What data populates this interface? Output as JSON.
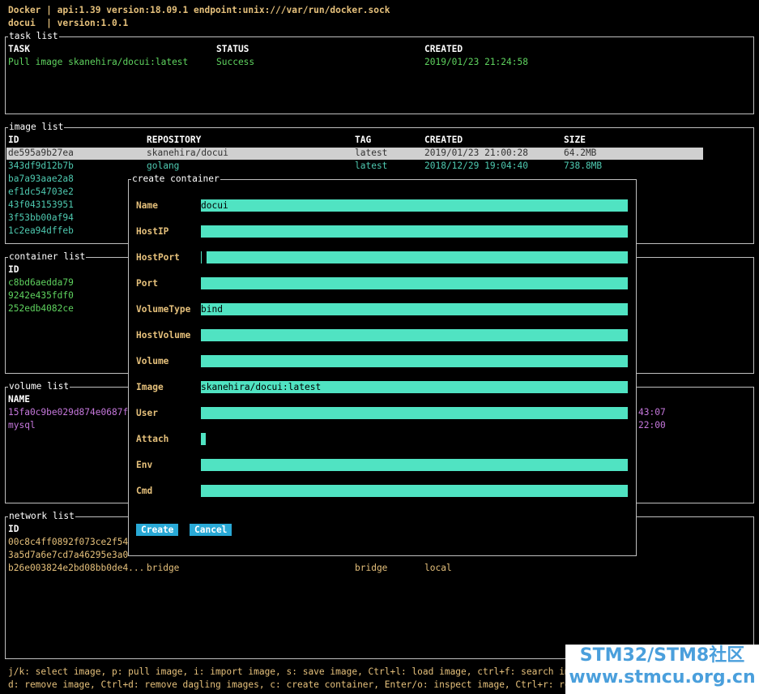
{
  "header": {
    "line1": "Docker | api:1.39 version:18.09.1 endpoint:unix:///var/run/docker.sock",
    "line2": "docui  | version:1.0.1"
  },
  "task_list": {
    "title": "task list",
    "columns": [
      "TASK",
      "STATUS",
      "CREATED"
    ],
    "rows": [
      {
        "task": "Pull image skanehira/docui:latest",
        "status": "Success",
        "created": "2019/01/23 21:24:58"
      }
    ]
  },
  "image_list": {
    "title": "image list",
    "columns": [
      "ID",
      "REPOSITORY",
      "TAG",
      "CREATED",
      "SIZE"
    ],
    "rows": [
      {
        "id": "de595a9b27ea",
        "repository": "skanehira/docui",
        "tag": "latest",
        "created": "2019/01/23 21:00:28",
        "size": "64.2MB"
      },
      {
        "id": "343df9d12b7b",
        "repository": "golang",
        "tag": "latest",
        "created": "2018/12/29 19:04:40",
        "size": "738.8MB"
      },
      {
        "id": "ba7a93aae2a8"
      },
      {
        "id": "ef1dc54703e2"
      },
      {
        "id": "43f043153951"
      },
      {
        "id": "3f53bb00af94"
      },
      {
        "id": "1c2ea94dffeb"
      }
    ]
  },
  "container_list": {
    "title": "container list",
    "columns": [
      "ID"
    ],
    "rows": [
      {
        "id": "c8bd6aedda79"
      },
      {
        "id": "9242e435fdf0"
      },
      {
        "id": "252edb4082ce"
      }
    ]
  },
  "volume_list": {
    "title": "volume list",
    "columns": [
      "NAME"
    ],
    "rows": [
      {
        "name": "15fa0c9be029d874e0687f",
        "tail": "43:07"
      },
      {
        "name": "mysql",
        "tail": "22:00"
      }
    ]
  },
  "network_list": {
    "title": "network list",
    "columns": [
      "ID"
    ],
    "rows": [
      {
        "id": "00c8c4ff0892f073ce2f54"
      },
      {
        "id": "3a5d7a6e7cd7a46295e3a0"
      },
      {
        "id": "b26e003824e2bd08bb0de4...",
        "name": "bridge",
        "driver": "bridge",
        "scope": "local"
      }
    ]
  },
  "dialog": {
    "title": "create container",
    "fields": [
      {
        "label": "Name",
        "value": "docui"
      },
      {
        "label": "HostIP",
        "value": ""
      },
      {
        "label": "HostPort",
        "value": ""
      },
      {
        "label": "Port",
        "value": ""
      },
      {
        "label": "VolumeType",
        "value": "bind"
      },
      {
        "label": "HostVolume",
        "value": ""
      },
      {
        "label": "Volume",
        "value": ""
      },
      {
        "label": "Image",
        "value": "skanehira/docui:latest"
      },
      {
        "label": "User",
        "value": ""
      },
      {
        "label": "Attach",
        "value": ""
      },
      {
        "label": "Env",
        "value": ""
      },
      {
        "label": "Cmd",
        "value": ""
      }
    ],
    "create_label": "Create",
    "cancel_label": "Cancel"
  },
  "footer": {
    "line1": "j/k: select image, p: pull image, i: import image, s: save image, Ctrl+l: load image, ctrl+f: search image,",
    "line2": "d: remove image, Ctrl+d: remove dagling images, c: create container, Enter/o: inspect image, Ctrl+r: refresh"
  },
  "watermark": {
    "line1": "STM32/STM8社区",
    "line2": "www.stmcu.org.cn"
  },
  "colors": {
    "accent_input": "#50e3c2",
    "button": "#29a9d6",
    "label": "#e5c07b"
  }
}
